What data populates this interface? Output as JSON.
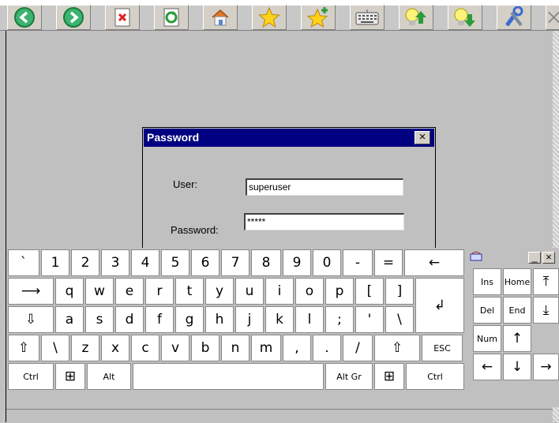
{
  "toolbar": {
    "buttons": [
      {
        "name": "back-button",
        "icon": "arrow-left-icon"
      },
      {
        "name": "forward-button",
        "icon": "arrow-right-icon"
      },
      {
        "name": "close-page-button",
        "icon": "page-close-icon"
      },
      {
        "name": "refresh-button",
        "icon": "refresh-icon"
      },
      {
        "name": "home-button",
        "icon": "home-icon"
      },
      {
        "name": "favorites-button",
        "icon": "star-icon"
      },
      {
        "name": "add-favorite-button",
        "icon": "star-plus-icon"
      },
      {
        "name": "keyboard-button",
        "icon": "keyboard-icon"
      },
      {
        "name": "upload-button",
        "icon": "bulb-up-icon"
      },
      {
        "name": "download-button",
        "icon": "bulb-down-icon"
      },
      {
        "name": "settings-button",
        "icon": "tools-icon"
      },
      {
        "name": "exit-button",
        "icon": "x-icon"
      }
    ]
  },
  "dialog": {
    "title": "Password",
    "close": "×",
    "user_label": "User:",
    "user_value": "superuser",
    "password_label": "Password:",
    "password_value": "*****"
  },
  "keyboard": {
    "row1": [
      "`",
      "1",
      "2",
      "3",
      "4",
      "5",
      "6",
      "7",
      "8",
      "9",
      "0",
      "-",
      "=",
      "←"
    ],
    "row2": [
      "⟶",
      "q",
      "w",
      "e",
      "r",
      "t",
      "y",
      "u",
      "i",
      "o",
      "p",
      "[",
      "]"
    ],
    "row3": [
      "⇩",
      "a",
      "s",
      "d",
      "f",
      "g",
      "h",
      "j",
      "k",
      "l",
      ";",
      "'",
      "\\"
    ],
    "row4": [
      "⇧",
      "\\",
      "z",
      "x",
      "c",
      "v",
      "b",
      "n",
      "m",
      ",",
      ".",
      "/",
      "⇧",
      "ESC"
    ],
    "row5": [
      "Ctrl",
      "⊞",
      "Alt",
      "",
      "Alt Gr",
      "⊞",
      "Ctrl"
    ],
    "enter": "↲"
  },
  "numpad": {
    "min": "_",
    "close": "×",
    "keys": [
      "Ins",
      "Home",
      "⤒",
      "Del",
      "End",
      "⤓",
      "Num",
      "↑",
      "←",
      "↓",
      "→"
    ]
  },
  "colors": {
    "title_bar": "#000080",
    "background": "#c0c0c0",
    "key_face": "#ffffff"
  }
}
